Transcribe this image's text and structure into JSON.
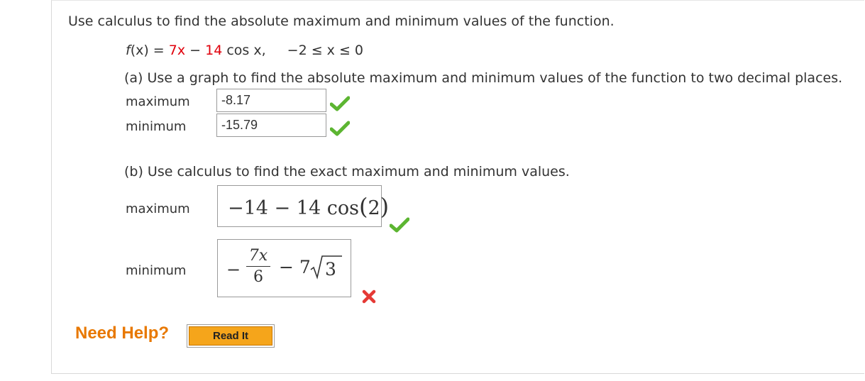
{
  "question": {
    "intro": "Use calculus to find the absolute maximum and minimum values of the function.",
    "function": {
      "fx": "f",
      "paren": "(x) = ",
      "term1": "7x",
      "minus": " − ",
      "coef": "14",
      "cos": " cos x,",
      "domain": "−2 ≤ x ≤ 0"
    }
  },
  "part_a": {
    "prompt": "(a) Use a graph to find the absolute maximum and minimum values of the function to two decimal places.",
    "maximum_label": "maximum",
    "maximum_value": "-8.17",
    "maximum_status": "correct",
    "minimum_label": "minimum",
    "minimum_value": "-15.79",
    "minimum_status": "correct"
  },
  "part_b": {
    "prompt": "(b) Use calculus to find the exact maximum and minimum values.",
    "maximum_label": "maximum",
    "maximum_answer": {
      "lead": "−14 − 14 cos",
      "lparen": "(",
      "arg": "2",
      "rparen": ")"
    },
    "maximum_status": "correct",
    "minimum_label": "minimum",
    "minimum_answer": {
      "sign": "−",
      "numerator": "7x",
      "denominator": "6",
      "rest": "− 7",
      "radicand": "3"
    },
    "minimum_status": "incorrect"
  },
  "help": {
    "label": "Need Help?",
    "read_it": "Read It"
  },
  "colors": {
    "accent_red": "#e0000c",
    "check_green": "#5cb531",
    "cross_red": "#e53935",
    "help_orange": "#e87800",
    "button_orange": "#f5a51b"
  }
}
